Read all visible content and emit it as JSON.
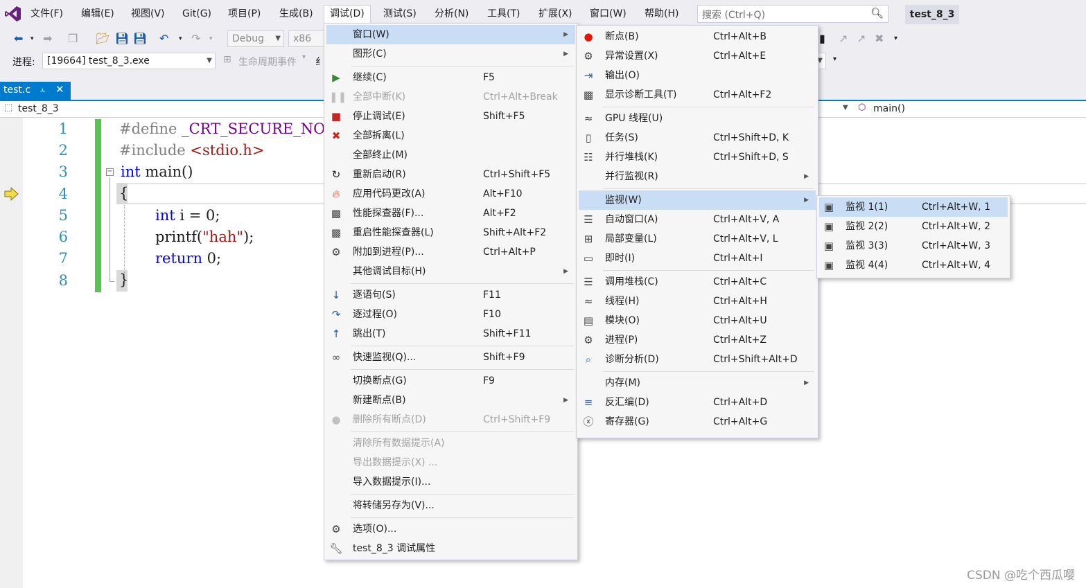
{
  "menubar": {
    "items": [
      "文件(F)",
      "编辑(E)",
      "视图(V)",
      "Git(G)",
      "项目(P)",
      "生成(B)",
      "调试(D)",
      "测试(S)",
      "分析(N)",
      "工具(T)",
      "扩展(X)",
      "窗口(W)",
      "帮助(H)"
    ],
    "search_placeholder": "搜索 (Ctrl+Q)",
    "solution_name": "test_8_3"
  },
  "toolbar": {
    "config": "Debug",
    "platform": "x86",
    "process_label": "进程:",
    "process_value": "[19664] test_8_3.exe",
    "lifecycle_label": "生命周期事件",
    "thread_prefix": "纟"
  },
  "editor": {
    "tab_name": "test.c",
    "nav_scope": "test_8_3",
    "nav_function": "main()",
    "line_numbers": [
      "1",
      "2",
      "3",
      "4",
      "5",
      "6",
      "7",
      "8"
    ],
    "lines": {
      "l1a": "#define ",
      "l1b": "_CRT_SECURE_NO_",
      "l2a": "#include ",
      "l2b": "<stdio.h>",
      "l3a": "int",
      "l3b": " main()",
      "l4": "{",
      "l5a": "int",
      "l5b": " i = 0;",
      "l6a": "printf(",
      "l6b": "\"hah\"",
      "l6c": ");",
      "l7a": "return",
      "l7b": " 0;",
      "l8": "}"
    }
  },
  "debug_menu": [
    {
      "label": "窗口(W)",
      "shortcut": "",
      "submenu": true,
      "highlight": true
    },
    {
      "label": "图形(C)",
      "shortcut": "",
      "submenu": true
    },
    {
      "label": "继续(C)",
      "shortcut": "F5",
      "icon": "play-icon"
    },
    {
      "label": "全部中断(K)",
      "shortcut": "Ctrl+Alt+Break",
      "disabled": true,
      "icon": "pause-icon"
    },
    {
      "label": "停止调试(E)",
      "shortcut": "Shift+F5",
      "icon": "stop-icon"
    },
    {
      "label": "全部拆离(L)",
      "shortcut": "",
      "icon": "detach-icon"
    },
    {
      "label": "全部终止(M)",
      "shortcut": ""
    },
    {
      "label": "重新启动(R)",
      "shortcut": "Ctrl+Shift+F5",
      "icon": "restart-icon"
    },
    {
      "label": "应用代码更改(A)",
      "shortcut": "Alt+F10",
      "icon": "hot-reload-icon"
    },
    {
      "label": "性能探查器(F)...",
      "shortcut": "Alt+F2",
      "icon": "profiler-icon"
    },
    {
      "label": "重启性能探查器(L)",
      "shortcut": "Shift+Alt+F2",
      "icon": "profiler-restart-icon"
    },
    {
      "label": "附加到进程(P)...",
      "shortcut": "Ctrl+Alt+P",
      "icon": "attach-icon"
    },
    {
      "label": "其他调试目标(H)",
      "shortcut": "",
      "submenu": true
    },
    {
      "label": "逐语句(S)",
      "shortcut": "F11",
      "icon": "step-into-icon"
    },
    {
      "label": "逐过程(O)",
      "shortcut": "F10",
      "icon": "step-over-icon"
    },
    {
      "label": "跳出(T)",
      "shortcut": "Shift+F11",
      "icon": "step-out-icon"
    },
    {
      "label": "快速监视(Q)...",
      "shortcut": "Shift+F9",
      "icon": "quickwatch-icon"
    },
    {
      "label": "切换断点(G)",
      "shortcut": "F9"
    },
    {
      "label": "新建断点(B)",
      "shortcut": "",
      "submenu": true
    },
    {
      "label": "删除所有断点(D)",
      "shortcut": "Ctrl+Shift+F9",
      "disabled": true,
      "icon": "delete-breakpoints-icon"
    },
    {
      "label": "清除所有数据提示(A)",
      "shortcut": "",
      "disabled": true
    },
    {
      "label": "导出数据提示(X) ...",
      "shortcut": "",
      "disabled": true
    },
    {
      "label": "导入数据提示(I)...",
      "shortcut": ""
    },
    {
      "label": "将转储另存为(V)...",
      "shortcut": ""
    },
    {
      "label": "选项(O)...",
      "shortcut": "",
      "icon": "gear-icon"
    },
    {
      "label": "test_8_3 调试属性",
      "shortcut": "",
      "icon": "wrench-icon"
    }
  ],
  "window_menu": [
    {
      "label": "断点(B)",
      "shortcut": "Ctrl+Alt+B",
      "icon": "breakpoints-icon"
    },
    {
      "label": "异常设置(X)",
      "shortcut": "Ctrl+Alt+E",
      "icon": "exception-icon"
    },
    {
      "label": "输出(O)",
      "shortcut": "",
      "icon": "output-icon"
    },
    {
      "label": "显示诊断工具(T)",
      "shortcut": "Ctrl+Alt+F2",
      "icon": "diagnostics-icon"
    },
    {
      "label": "GPU 线程(U)",
      "shortcut": "",
      "icon": "gpu-threads-icon"
    },
    {
      "label": "任务(S)",
      "shortcut": "Ctrl+Shift+D, K",
      "icon": "tasks-icon"
    },
    {
      "label": "并行堆栈(K)",
      "shortcut": "Ctrl+Shift+D, S",
      "icon": "parallel-stacks-icon"
    },
    {
      "label": "并行监视(R)",
      "shortcut": "",
      "submenu": true
    },
    {
      "label": "监视(W)",
      "shortcut": "",
      "submenu": true,
      "highlight": true
    },
    {
      "label": "自动窗口(A)",
      "shortcut": "Ctrl+Alt+V, A",
      "icon": "autos-icon"
    },
    {
      "label": "局部变量(L)",
      "shortcut": "Ctrl+Alt+V, L",
      "icon": "locals-icon"
    },
    {
      "label": "即时(I)",
      "shortcut": "Ctrl+Alt+I",
      "icon": "immediate-icon"
    },
    {
      "label": "调用堆栈(C)",
      "shortcut": "Ctrl+Alt+C",
      "icon": "call-stack-icon"
    },
    {
      "label": "线程(H)",
      "shortcut": "Ctrl+Alt+H",
      "icon": "threads-icon"
    },
    {
      "label": "模块(O)",
      "shortcut": "Ctrl+Alt+U",
      "icon": "modules-icon"
    },
    {
      "label": "进程(P)",
      "shortcut": "Ctrl+Alt+Z",
      "icon": "processes-icon"
    },
    {
      "label": "诊断分析(D)",
      "shortcut": "Ctrl+Shift+Alt+D",
      "icon": "diagnostic-analysis-icon"
    },
    {
      "label": "内存(M)",
      "shortcut": "",
      "submenu": true
    },
    {
      "label": "反汇编(D)",
      "shortcut": "Ctrl+Alt+D",
      "icon": "disassembly-icon"
    },
    {
      "label": "寄存器(G)",
      "shortcut": "Ctrl+Alt+G",
      "icon": "registers-icon"
    }
  ],
  "watch_menu": [
    {
      "label": "监视 1(1)",
      "shortcut": "Ctrl+Alt+W, 1",
      "highlight": true
    },
    {
      "label": "监视 2(2)",
      "shortcut": "Ctrl+Alt+W, 2"
    },
    {
      "label": "监视 3(3)",
      "shortcut": "Ctrl+Alt+W, 3"
    },
    {
      "label": "监视 4(4)",
      "shortcut": "Ctrl+Alt+W, 4"
    }
  ],
  "watermark": "CSDN @吃个西瓜嘤"
}
